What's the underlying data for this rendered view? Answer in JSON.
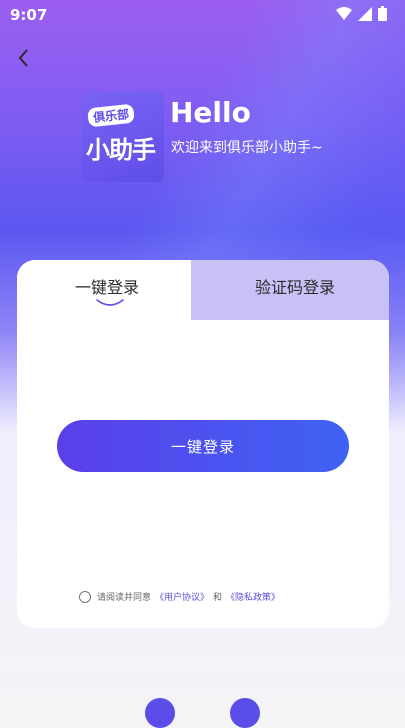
{
  "status": {
    "time": "9:07"
  },
  "brand": {
    "logo_tag": "俱乐部",
    "logo_main": "小助手",
    "hello": "Hello",
    "welcome": "欢迎来到俱乐部小助手~"
  },
  "tabs": [
    {
      "label": "一键登录",
      "active": true
    },
    {
      "label": "验证码登录",
      "active": false
    }
  ],
  "login_button": "一键登录",
  "agreement": {
    "prefix": "请阅读并同意",
    "user_agreement": "《用户协议》",
    "and": "和",
    "privacy": "《隐私政策》"
  },
  "colors": {
    "accent": "#5b4ee8",
    "button_start": "#5b3fe8",
    "button_end": "#3e63f5",
    "inactive_tab": "#c7c1f6"
  },
  "icons": [
    "back-arrow",
    "wifi",
    "signal",
    "battery",
    "wechat",
    "qq"
  ]
}
